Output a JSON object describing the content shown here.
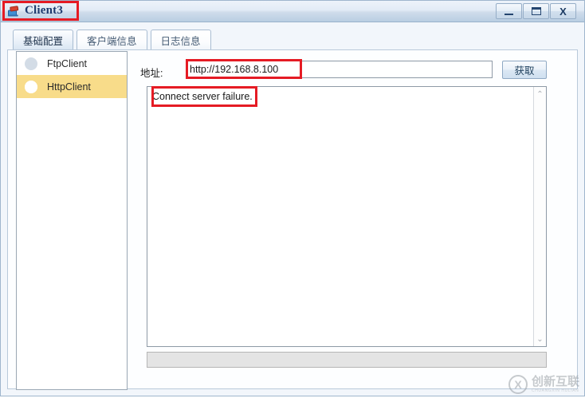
{
  "window": {
    "title": "Client3",
    "icon": "app-window-icon",
    "controls": {
      "minimize": "–",
      "maximize": "▭",
      "close": "X"
    }
  },
  "tabs": [
    {
      "label": "基础配置",
      "selected": true
    },
    {
      "label": "客户端信息",
      "selected": false
    },
    {
      "label": "日志信息",
      "selected": false
    }
  ],
  "sidebar": {
    "items": [
      {
        "label": "FtpClient",
        "selected": false
      },
      {
        "label": "HttpClient",
        "selected": true
      }
    ]
  },
  "main": {
    "address_label": "地址:",
    "url_value": "http://192.168.8.100",
    "url_placeholder": "",
    "fetch_button": "获取",
    "log_text": "Connect server failure.",
    "status_text": ""
  },
  "scrollbar": {
    "up_arrow": "⌃",
    "down_arrow": "⌄"
  },
  "annotations": {
    "accent_color": "#e51b24",
    "boxes": [
      "title",
      "url",
      "log-message"
    ]
  },
  "watermark": {
    "mark": "ⓧ",
    "name_cn": "创新互联",
    "name_en": "CHUANGXIN HULIAN"
  }
}
